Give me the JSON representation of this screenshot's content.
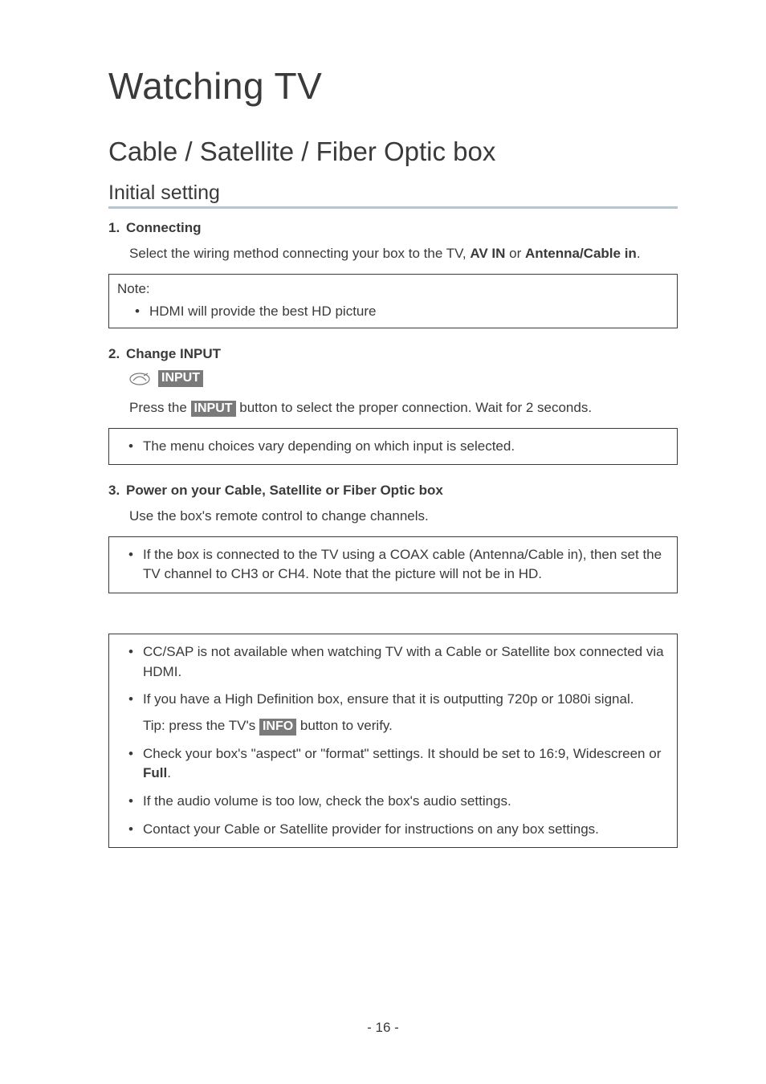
{
  "page": {
    "title": "Watching TV",
    "section": "Cable / Satellite / Fiber Optic box",
    "subsection": "Initial setting",
    "page_number": "- 16 -"
  },
  "steps": [
    {
      "num": "1.",
      "title": "Connecting",
      "para_pre": "Select the wiring method connecting your box to the TV, ",
      "para_bold1": "AV IN",
      "para_mid": " or ",
      "para_bold2": "Antenna/Cable in",
      "para_post": "."
    },
    {
      "num": "2.",
      "title": "Change INPUT",
      "button_label": "INPUT",
      "para_pre": "Press the ",
      "para_btn": "INPUT",
      "para_post": " button to select the proper connection. Wait for 2 seconds."
    },
    {
      "num": "3.",
      "title": "Power on your Cable, Satellite or Fiber Optic box",
      "para": "Use the box's remote control to change channels."
    }
  ],
  "note_box": {
    "label": "Note:",
    "bullets": [
      "HDMI will provide the best HD picture"
    ]
  },
  "bullet_box1": {
    "bullets": [
      "The menu choices vary depending on which input is selected."
    ]
  },
  "bullet_box2": {
    "bullets": [
      "If the box is connected to the TV using a COAX cable (Antenna/Cable in), then set the TV channel to CH3 or CH4. Note that the picture will not be in HD."
    ]
  },
  "bullet_box3": {
    "items": [
      {
        "text": "CC/SAP is not available when watching TV with a Cable or Satellite box connected via HDMI."
      },
      {
        "text": "If you have a High Definition box, ensure that it is outputting 720p or 1080i signal.",
        "tip_pre": "Tip: press the TV's ",
        "tip_btn": "INFO",
        "tip_post": " button to verify."
      },
      {
        "text_pre": "Check your box's \"aspect\" or \"format\" settings. It should be set to 16:9, Widescreen or ",
        "text_bold": "Full",
        "text_post": "."
      },
      {
        "text": "If the audio volume is too low, check the box's audio settings."
      },
      {
        "text": "Contact your Cable or Satellite provider for instructions on any box settings."
      }
    ]
  }
}
